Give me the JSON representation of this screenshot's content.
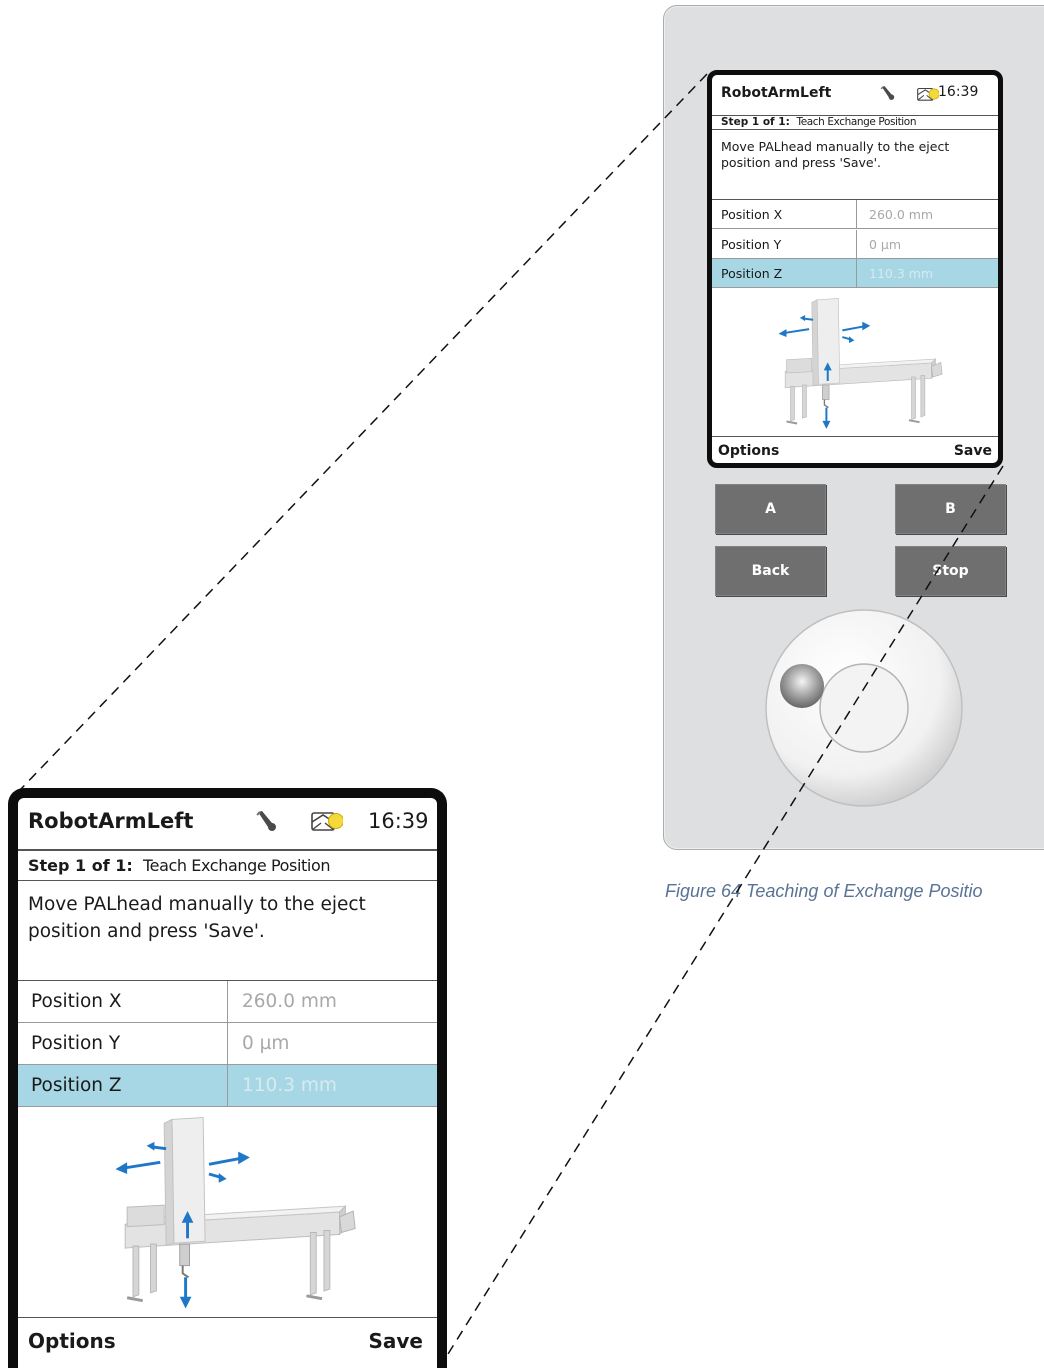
{
  "device_screen": {
    "title": "RobotArmLeft",
    "time": "16:39",
    "step_label": "Step 1 of 1:",
    "step_title": "Teach Exchange Position",
    "message_line1": "Move PALhead manually to the eject",
    "message_line2": "position and press 'Save'.",
    "positions": [
      {
        "label": "Position X",
        "value": "260.0 mm",
        "selected": false
      },
      {
        "label": "Position Y",
        "value": "0 µm",
        "selected": false
      },
      {
        "label": "Position Z",
        "value": "110.3 mm",
        "selected": true
      }
    ],
    "softkey_left": "Options",
    "softkey_right": "Save",
    "icons": [
      "wrench-icon",
      "message-envelope-icon",
      "status-led-icon"
    ],
    "status_led_color": "#f5d93a",
    "selection_color": "#a7d7e4",
    "arrow_color": "#1f77c8"
  },
  "hardware_buttons": {
    "a": "A",
    "b": "B",
    "back": "Back",
    "stop": "Stop"
  },
  "caption": "Figure 64 Teaching of Exchange Positio"
}
